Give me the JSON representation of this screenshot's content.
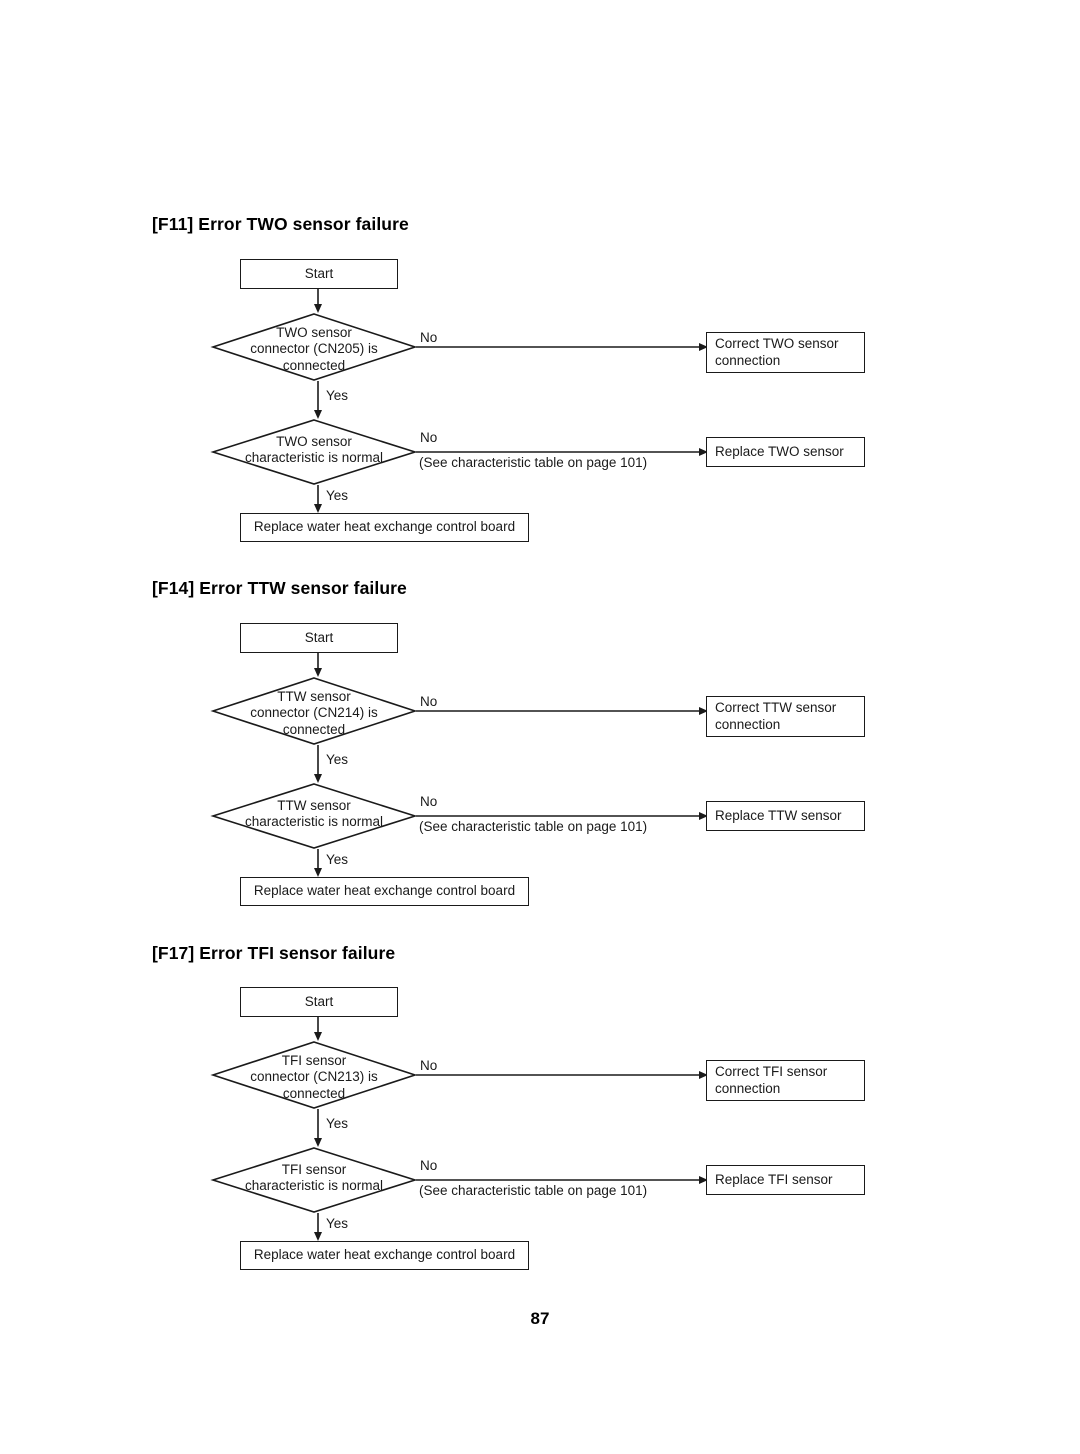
{
  "page": {
    "number": "87"
  },
  "common": {
    "start_label": "Start",
    "yes_label": "Yes",
    "no_label": "No",
    "characteristic_note": "(See characteristic table on page 101)",
    "final_action": "Replace water heat exchange control board"
  },
  "sections": [
    {
      "heading": "[F11] Error TWO sensor failure",
      "start": "Start",
      "decision1": {
        "line1": "TWO sensor",
        "line2": "connector (CN205) is",
        "line3": "connected",
        "yes": "Yes",
        "no": "No"
      },
      "action1": {
        "line1": "Correct TWO sensor",
        "line2": "connection"
      },
      "decision2": {
        "line1": "TWO sensor",
        "line2": "characteristic is normal",
        "yes": "Yes",
        "no": "No",
        "note": "(See characteristic table on page 101)"
      },
      "action2": "Replace TWO sensor",
      "final": "Replace water heat exchange control board"
    },
    {
      "heading": "[F14] Error TTW sensor failure",
      "start": "Start",
      "decision1": {
        "line1": "TTW sensor",
        "line2": "connector (CN214) is",
        "line3": "connected",
        "yes": "Yes",
        "no": "No"
      },
      "action1": {
        "line1": "Correct TTW sensor",
        "line2": "connection"
      },
      "decision2": {
        "line1": "TTW sensor",
        "line2": "characteristic is normal",
        "yes": "Yes",
        "no": "No",
        "note": "(See characteristic table on page 101)"
      },
      "action2": "Replace TTW sensor",
      "final": "Replace water heat exchange control board"
    },
    {
      "heading": "[F17] Error TFI sensor failure",
      "start": "Start",
      "decision1": {
        "line1": "TFI sensor",
        "line2": "connector (CN213) is",
        "line3": "connected",
        "yes": "Yes",
        "no": "No"
      },
      "action1": {
        "line1": "Correct TFI sensor",
        "line2": "connection"
      },
      "decision2": {
        "line1": "TFI sensor",
        "line2": "characteristic is normal",
        "yes": "Yes",
        "no": "No",
        "note": "(See characteristic table on page 101)"
      },
      "action2": "Replace TFI sensor",
      "final": "Replace water heat exchange control board"
    }
  ]
}
